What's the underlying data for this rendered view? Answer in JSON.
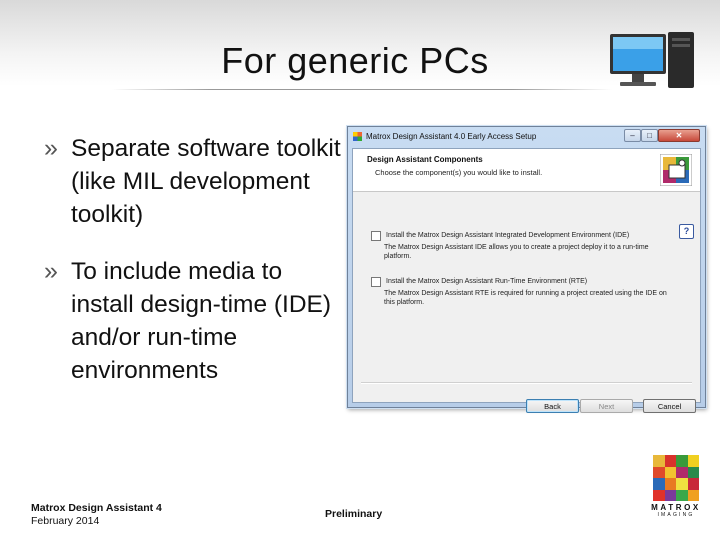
{
  "slide": {
    "title": "For generic PCs",
    "bullets": [
      {
        "mark": "»",
        "text": "Separate software toolkit (like MIL development toolkit)"
      },
      {
        "mark": "»",
        "text": "To include media to install design-time (IDE) and/or run-time environments"
      }
    ]
  },
  "dialog": {
    "title": "Matrox Design Assistant 4.0 Early Access Setup",
    "controls": {
      "min": "–",
      "max": "□",
      "close": "✕"
    },
    "heading": "Design Assistant Components",
    "subheading": "Choose the component(s) you would like to install.",
    "help": "?",
    "options": [
      {
        "label": "Install the Matrox Design Assistant Integrated Development Environment (IDE)",
        "description": "The Matrox Design Assistant IDE allows you to create a project deploy it to a run-time platform.",
        "checked": false
      },
      {
        "label": "Install the Matrox Design Assistant Run-Time Environment (RTE)",
        "description": "The Matrox Design Assistant RTE is required for running a project created using the IDE on this platform.",
        "checked": false
      }
    ],
    "buttons": {
      "back": "Back",
      "next": "Next",
      "cancel": "Cancel"
    }
  },
  "footer": {
    "product": "Matrox Design Assistant 4",
    "date": "February 2014",
    "status": "Preliminary"
  },
  "logo": {
    "word": "MATROX",
    "sub": "IMAGING",
    "colors": [
      "#e8b83a",
      "#d8322b",
      "#3a9a3a",
      "#f0d020",
      "#e04a2a",
      "#f2c230",
      "#b02a6a",
      "#2a8a4a",
      "#2a6ab8",
      "#e87a22",
      "#f0e040",
      "#c8283a",
      "#e0322a",
      "#7a3a9a",
      "#3aa84a",
      "#f0a020"
    ]
  }
}
